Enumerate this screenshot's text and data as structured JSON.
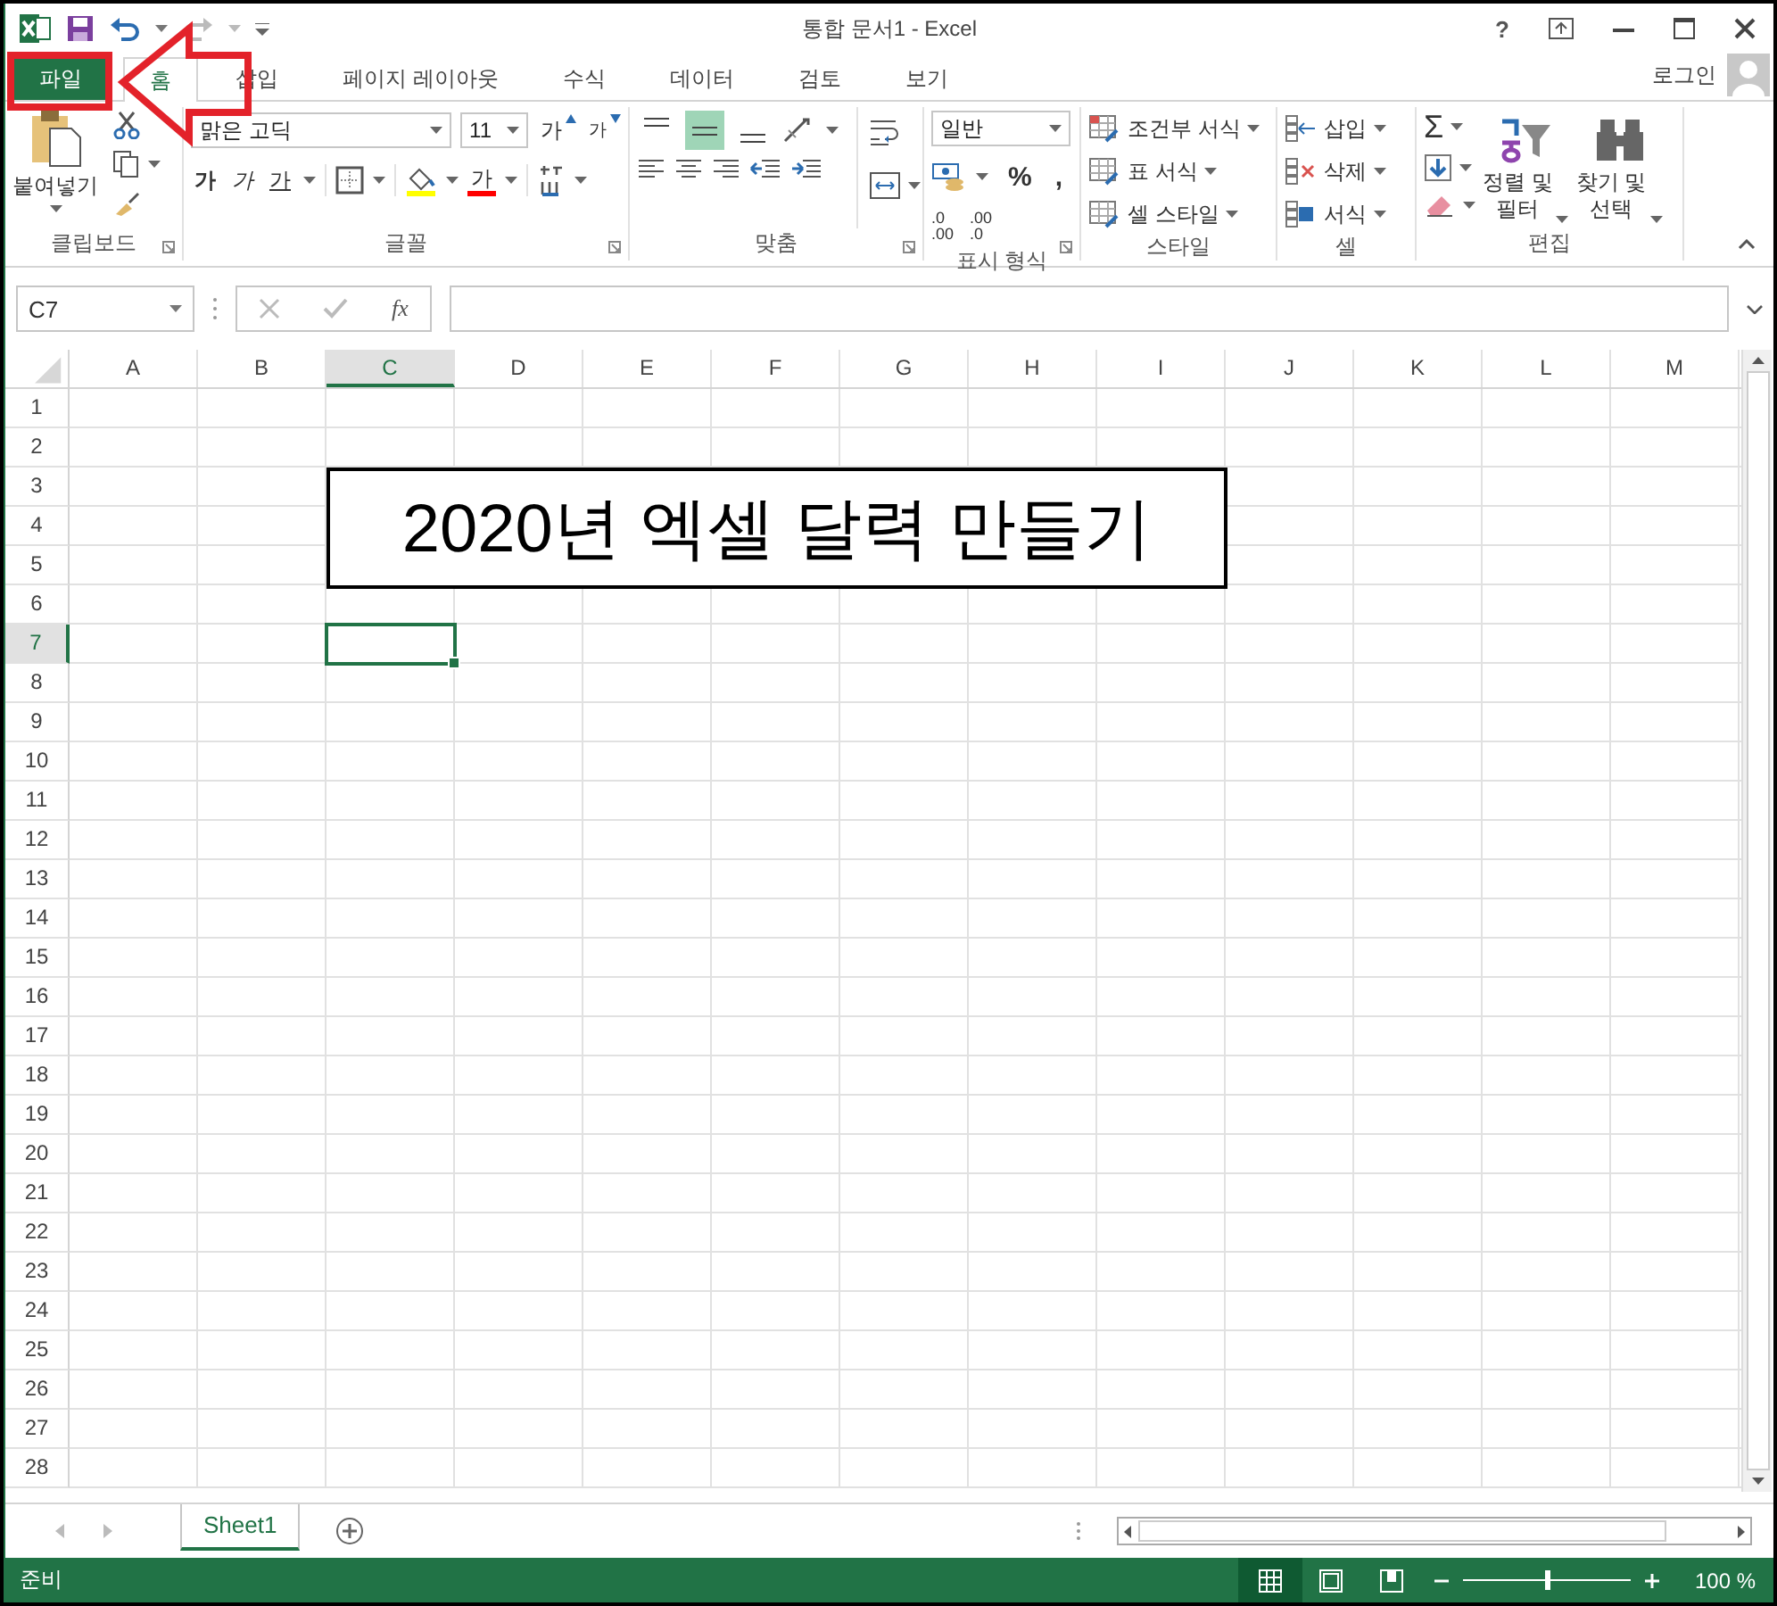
{
  "window": {
    "title": "통합 문서1 - Excel",
    "help": "?"
  },
  "tabs": [
    {
      "label": "파일",
      "kind": "file",
      "selected": false
    },
    {
      "label": "홈",
      "kind": "tab",
      "selected": true
    },
    {
      "label": "삽입",
      "kind": "tab",
      "selected": false
    },
    {
      "label": "페이지 레이아웃",
      "kind": "tab",
      "selected": false
    },
    {
      "label": "수식",
      "kind": "tab",
      "selected": false
    },
    {
      "label": "데이터",
      "kind": "tab",
      "selected": false
    },
    {
      "label": "검토",
      "kind": "tab",
      "selected": false
    },
    {
      "label": "보기",
      "kind": "tab",
      "selected": false
    }
  ],
  "account": {
    "label": "로그인"
  },
  "clipboard": {
    "label": "클립보드",
    "paste": "붙여넣기"
  },
  "font": {
    "label": "글꼴",
    "font_name": "맑은 고딕",
    "font_size": "11",
    "grow": "가",
    "shrink": "가",
    "bold": "가",
    "italic": "가",
    "underline": "가",
    "font_color": "가"
  },
  "alignment": {
    "label": "맞춤",
    "vertical": [
      {
        "selected": false
      },
      {
        "selected": true
      },
      {
        "selected": false
      }
    ]
  },
  "number": {
    "label": "표시 형식",
    "format": "일반",
    "percent": "%",
    "comma": ",",
    "decimals": [
      {
        "top": ".0",
        "bottom": ".00"
      },
      {
        "top": ".00",
        "bottom": ".0"
      }
    ]
  },
  "styles": {
    "label": "스타일",
    "items": [
      "조건부 서식",
      "표 서식",
      "셀 스타일"
    ]
  },
  "cells": {
    "label": "셀",
    "items": [
      "삽입",
      "삭제",
      "서식"
    ]
  },
  "editing": {
    "label": "편집",
    "autosum": "Σ",
    "sort": [
      "정렬 및",
      "필터"
    ],
    "find": [
      "찾기 및",
      "선택"
    ]
  },
  "formula_bar": {
    "name_box": "C7",
    "function_label": "fx"
  },
  "grid": {
    "columns": [
      {
        "label": "A",
        "selected": false
      },
      {
        "label": "B",
        "selected": false
      },
      {
        "label": "C",
        "selected": true
      },
      {
        "label": "D",
        "selected": false
      },
      {
        "label": "E",
        "selected": false
      },
      {
        "label": "F",
        "selected": false
      },
      {
        "label": "G",
        "selected": false
      },
      {
        "label": "H",
        "selected": false
      },
      {
        "label": "I",
        "selected": false
      },
      {
        "label": "J",
        "selected": false
      },
      {
        "label": "K",
        "selected": false
      },
      {
        "label": "L",
        "selected": false
      },
      {
        "label": "M",
        "selected": false
      }
    ],
    "rows": [
      {
        "label": "1",
        "selected": false
      },
      {
        "label": "2",
        "selected": false
      },
      {
        "label": "3",
        "selected": false
      },
      {
        "label": "4",
        "selected": false
      },
      {
        "label": "5",
        "selected": false
      },
      {
        "label": "6",
        "selected": false
      },
      {
        "label": "7",
        "selected": true
      },
      {
        "label": "8",
        "selected": false
      },
      {
        "label": "9",
        "selected": false
      },
      {
        "label": "10",
        "selected": false
      },
      {
        "label": "11",
        "selected": false
      },
      {
        "label": "12",
        "selected": false
      },
      {
        "label": "13",
        "selected": false
      },
      {
        "label": "14",
        "selected": false
      },
      {
        "label": "15",
        "selected": false
      },
      {
        "label": "16",
        "selected": false
      },
      {
        "label": "17",
        "selected": false
      },
      {
        "label": "18",
        "selected": false
      },
      {
        "label": "19",
        "selected": false
      },
      {
        "label": "20",
        "selected": false
      },
      {
        "label": "21",
        "selected": false
      },
      {
        "label": "22",
        "selected": false
      },
      {
        "label": "23",
        "selected": false
      },
      {
        "label": "24",
        "selected": false
      },
      {
        "label": "25",
        "selected": false
      },
      {
        "label": "26",
        "selected": false
      },
      {
        "label": "27",
        "selected": false
      },
      {
        "label": "28",
        "selected": false
      }
    ],
    "title_text": "2020년 엑셀 달력 만들기"
  },
  "sheet_tabs": [
    {
      "label": "Sheet1",
      "selected": true
    }
  ],
  "status_bar": {
    "text": "준비",
    "views": [
      {
        "selected": true
      },
      {
        "selected": false
      },
      {
        "selected": false
      }
    ],
    "zoom": {
      "level": 0.5
    },
    "zoom_text": "100 %"
  }
}
